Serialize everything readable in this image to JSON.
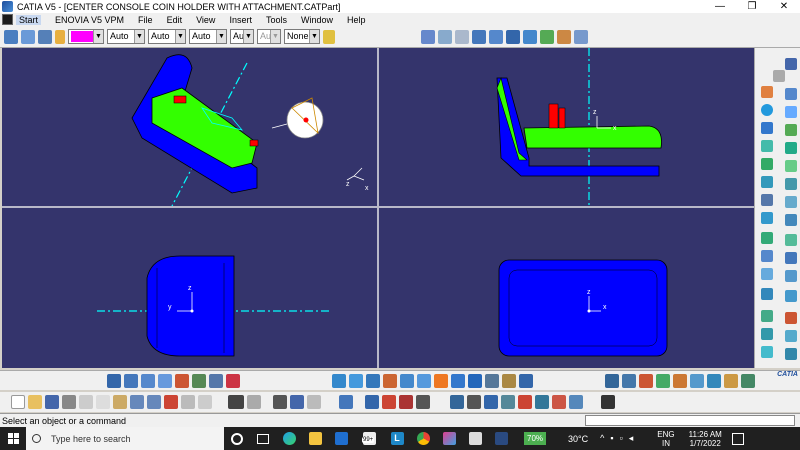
{
  "window": {
    "title": "CATIA V5 - [CENTER CONSOLE COIN HOLDER WITH ATTACHMENT.CATPart]",
    "minimize": "—",
    "restore": "❐",
    "close": "✕"
  },
  "menu": {
    "items": [
      "Start",
      "ENOVIA V5 VPM",
      "File",
      "Edit",
      "View",
      "Insert",
      "Tools",
      "Window",
      "Help"
    ]
  },
  "toolbar": {
    "color_swatch": "#ff00ff",
    "combos": [
      "Auto",
      "Auto",
      "Auto",
      "Aut",
      "Aut",
      "None"
    ]
  },
  "viewports": {
    "background": "#34346c",
    "axis_labels": {
      "x": "x",
      "y": "y",
      "z": "z"
    },
    "part_colors": {
      "body": "#0000ff",
      "top": "#33ff00",
      "feature": "#ff0000",
      "axis": "#00ffff"
    }
  },
  "status": {
    "prompt": "Select an object or a command"
  },
  "taskbar": {
    "search_placeholder": "Type here to search",
    "store_badge": "99+",
    "battery": "70%",
    "weather": "30°C",
    "language_top": "ENG",
    "language_bottom": "IN",
    "time": "11:26 AM",
    "date": "1/7/2022"
  },
  "brand": {
    "logo_text": "CATIA"
  }
}
